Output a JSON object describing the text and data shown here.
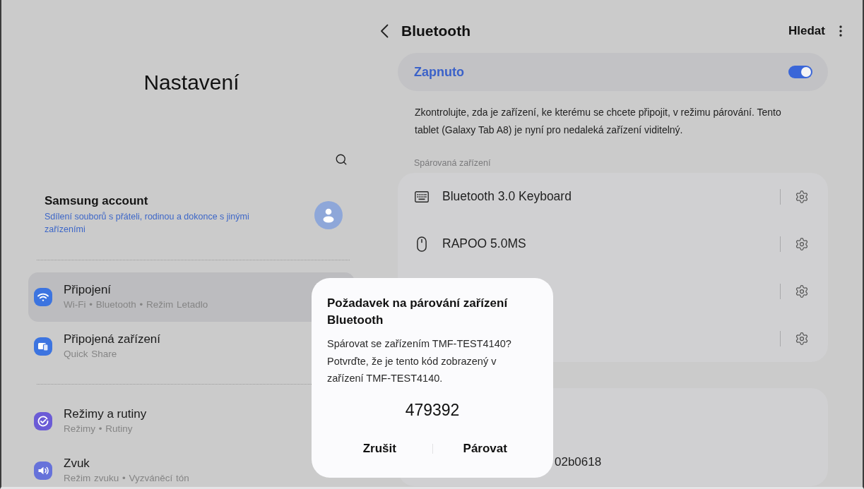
{
  "settings_panel": {
    "title": "Nastavení",
    "account": {
      "title": "Samsung account",
      "subtitle": "Sdílení souborů s přáteli, rodinou a dokonce s jinými zařízeními"
    },
    "groups": [
      {
        "items": [
          {
            "kind": "wifi",
            "title": "Připojení",
            "subtitle": "Wi-Fi • Bluetooth • Režim Letadlo",
            "selected": true
          },
          {
            "kind": "devices",
            "title": "Připojená zařízení",
            "subtitle": "Quick Share",
            "selected": false
          }
        ]
      },
      {
        "items": [
          {
            "kind": "modes",
            "title": "Režimy a rutiny",
            "subtitle": "Režimy • Rutiny",
            "selected": false
          },
          {
            "kind": "sound",
            "title": "Zvuk",
            "subtitle": "Režim zvuku • Vyzváněcí tón",
            "selected": false
          }
        ]
      }
    ]
  },
  "bluetooth_page": {
    "title": "Bluetooth",
    "search_label": "Hledat",
    "master_switch": {
      "label": "Zapnuto",
      "on": true
    },
    "description": "Zkontrolujte, zda je zařízení, ke kterému se chcete připojit, v režimu párování. Tento tablet (Galaxy Tab A8) je nyní pro nedaleká zařízení viditelný.",
    "paired_heading": "Spárovaná zařízení",
    "paired_devices": [
      {
        "kind": "keyboard",
        "name": "Bluetooth 3.0 Keyboard"
      },
      {
        "kind": "mouse",
        "name": "RAPOO 5.0MS"
      },
      {
        "kind": "covered"
      },
      {
        "kind": "covered"
      }
    ],
    "section_3": {
      "text": "02b0618"
    }
  },
  "pairing_dialog": {
    "title": "Požadavek na párování zařízení Bluetooth",
    "message": "Spárovat se zařízením TMF-TEST4140? Potvrďte, že je tento kód zobrazený v zařízení TMF-TEST4140.",
    "code": "479392",
    "buttons": [
      "Zrušit",
      "Párovat"
    ]
  }
}
